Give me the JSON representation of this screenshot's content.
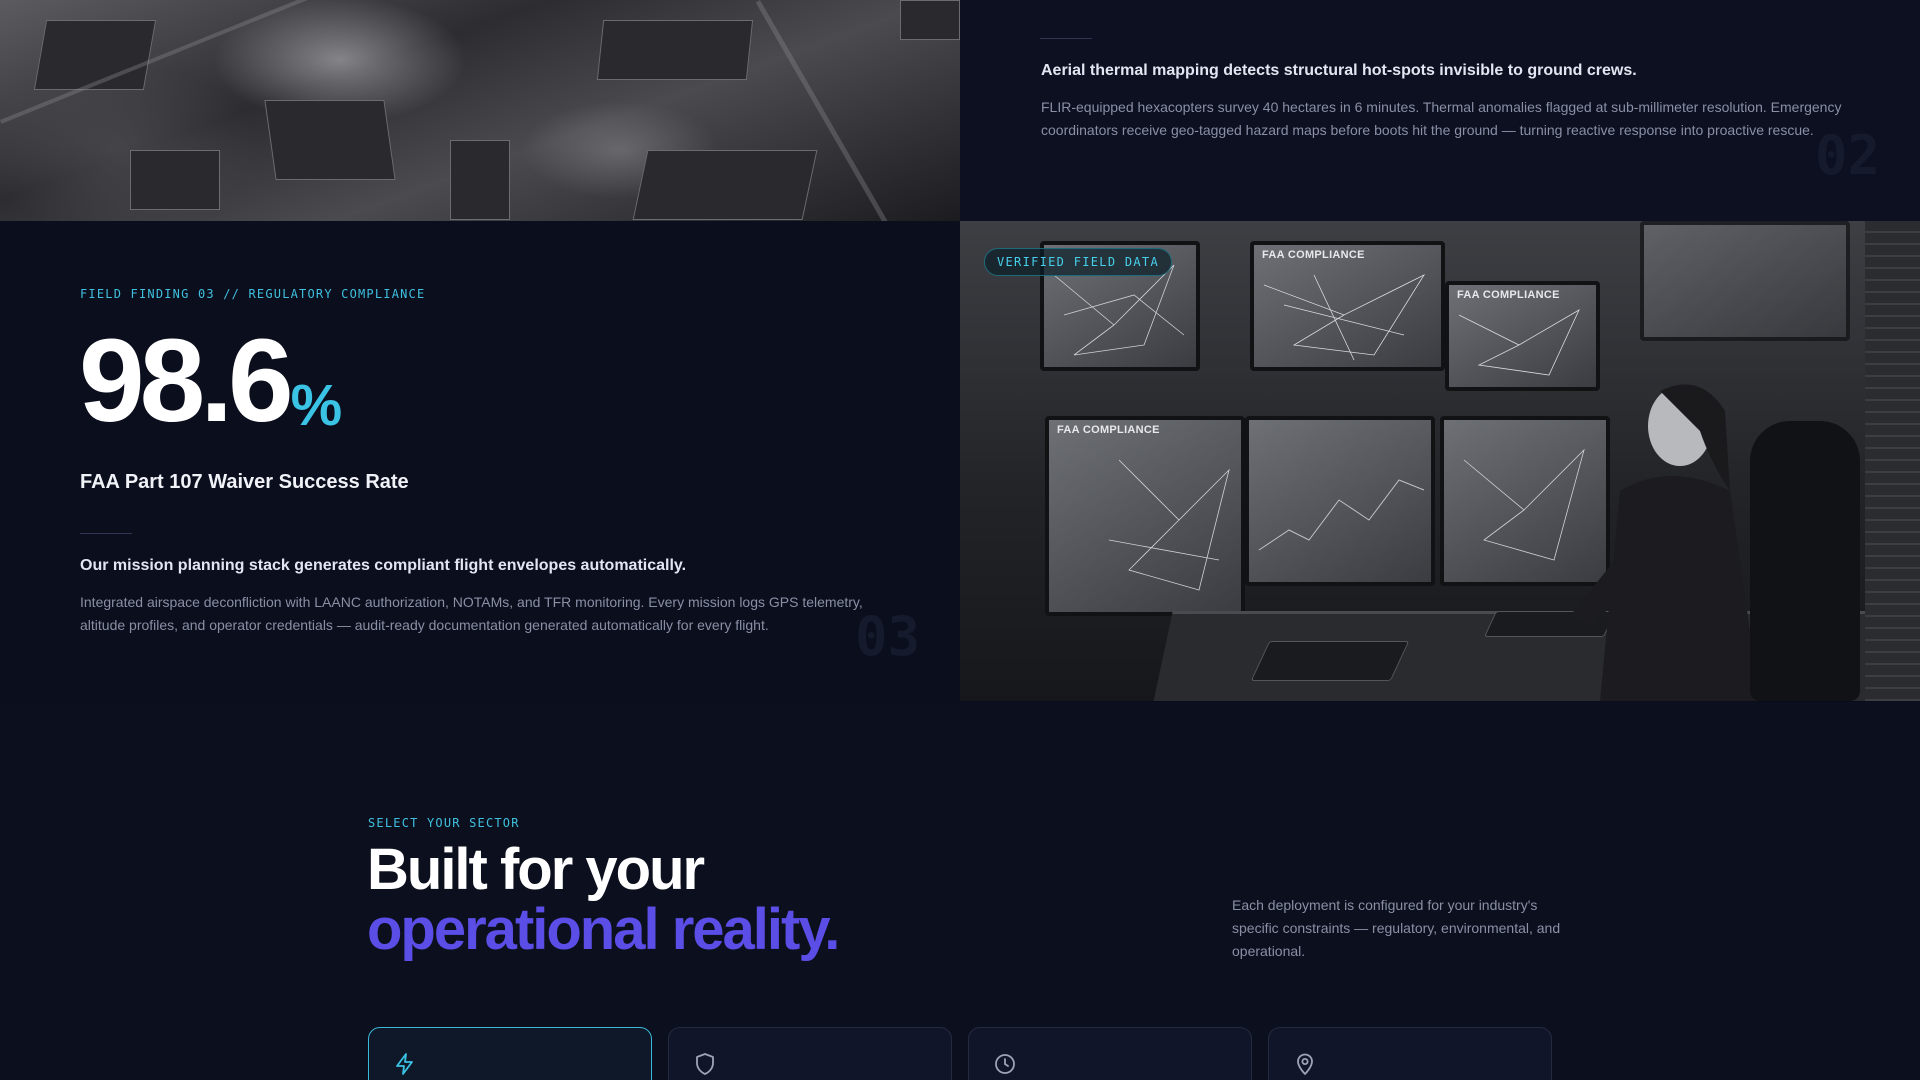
{
  "finding02": {
    "lead": "Aerial thermal mapping detects structural hot-spots invisible to ground crews.",
    "body": "FLIR-equipped hexacopters survey 40 hectares in 6 minutes. Thermal anomalies flagged at sub-millimeter resolution. Emergency coordinators receive geo-tagged hazard maps before boots hit the ground — turning reactive response into proactive rescue.",
    "index": "02"
  },
  "finding03": {
    "eyebrow": "FIELD FINDING 03 // REGULATORY COMPLIANCE",
    "stat_value": "98.6",
    "stat_unit": "%",
    "stat_label": "FAA Part 107 Waiver Success Rate",
    "lead": "Our mission planning stack generates compliant flight envelopes automatically.",
    "body": "Integrated airspace deconfliction with LAANC authorization, NOTAMs, and TFR monitoring. Every mission logs GPS telemetry, altitude profiles, and operator credentials — audit-ready documentation generated automatically for every flight.",
    "index": "03",
    "badge": "VERIFIED FIELD DATA",
    "monitor_caption": "FAA COMPLIANCE"
  },
  "sector": {
    "eyebrow": "SELECT YOUR SECTOR",
    "heading_line1": "Built for your",
    "heading_line2": "operational reality.",
    "description": "Each deployment is configured for your industry's specific constraints — regulatory, environmental, and operational.",
    "cards": [
      {
        "icon": "lightning-icon",
        "active": true
      },
      {
        "icon": "shield-icon",
        "active": false
      },
      {
        "icon": "clock-icon",
        "active": false
      },
      {
        "icon": "map-pin-icon",
        "active": false
      }
    ]
  },
  "colors": {
    "accent_cyan": "#3bc3e6",
    "accent_purple": "#5b4ee6",
    "background": "#0b0e1a"
  }
}
